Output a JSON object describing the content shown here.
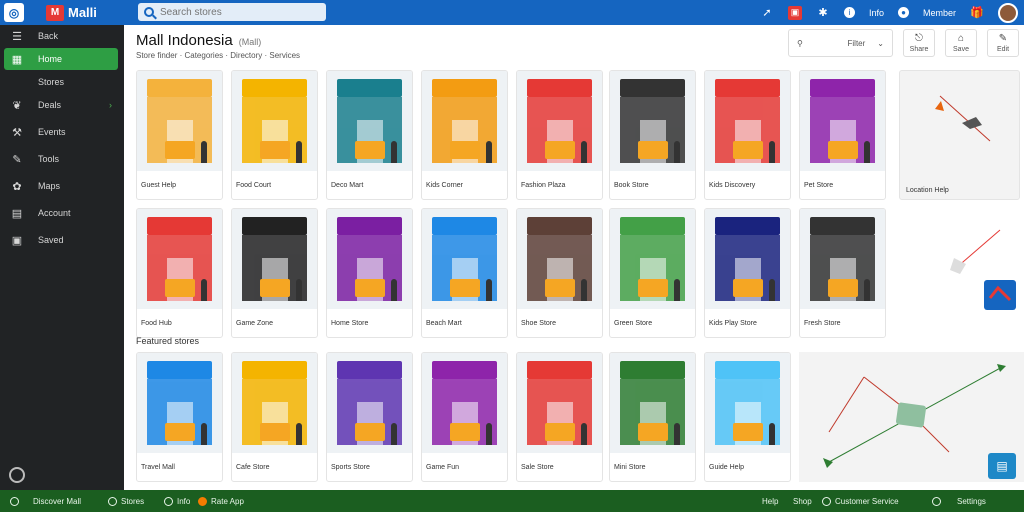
{
  "topbar": {
    "app_icon": "globe-icon",
    "brand_name": "Malli",
    "brand_mark": "M",
    "search_placeholder": "Search stores",
    "icons": [
      "pin-icon",
      "store-badge-icon",
      "bluetooth-icon",
      "info-icon"
    ],
    "info_label": "Info",
    "user_label": "Member",
    "gift_icon": "gift-icon"
  },
  "sidebar": {
    "items": [
      {
        "label": "Back",
        "icon": "menu-icon",
        "active": false
      },
      {
        "label": "Home",
        "icon": "store-icon",
        "active": true
      },
      {
        "label": "Stores",
        "icon": "",
        "active": false
      },
      {
        "label": "Deals",
        "icon": "leaf-icon",
        "active": false,
        "chevron": true
      },
      {
        "label": "Events",
        "icon": "wrench-icon",
        "active": false
      },
      {
        "label": "Tools",
        "icon": "brush-icon",
        "active": false
      },
      {
        "label": "Maps",
        "icon": "gear-icon",
        "active": false
      },
      {
        "label": "Account",
        "icon": "document-icon",
        "active": false
      },
      {
        "label": "Saved",
        "icon": "bag-icon",
        "active": false
      }
    ]
  },
  "main": {
    "title": "Mall Indonesia",
    "title_tag": "(Mall)",
    "subtitle": "Store finder  ·  Categories  ·  Directory  ·  Services",
    "filter_label": "Filter",
    "actions": [
      {
        "label": "Share",
        "icon": "share-icon"
      },
      {
        "label": "Save",
        "icon": "bag-icon"
      },
      {
        "label": "Edit",
        "icon": "edit-icon"
      }
    ],
    "section_label": "Featured stores"
  },
  "cards_row1": [
    {
      "caption": "Guest Help",
      "sign": "",
      "color": "#f4b23c"
    },
    {
      "caption": "Food Court",
      "sign": "",
      "color": "#f4b400"
    },
    {
      "caption": "Deco Mart",
      "sign": "",
      "color": "#1a7f8e"
    },
    {
      "caption": "Kids Corner",
      "sign": "",
      "color": "#f39c12"
    },
    {
      "caption": "Fashion Plaza",
      "sign": "",
      "color": "#e53935"
    },
    {
      "caption": "Book Store",
      "sign": "",
      "color": "#333333"
    },
    {
      "caption": "Kids Discovery",
      "sign": "",
      "color": "#e53935"
    },
    {
      "caption": "Pet Store",
      "sign": "",
      "color": "#8e24aa"
    }
  ],
  "cards_row2": [
    {
      "caption": "Food Hub",
      "sign": "",
      "color": "#e53935"
    },
    {
      "caption": "Game Zone",
      "sign": "",
      "color": "#222222"
    },
    {
      "caption": "Home Store",
      "sign": "",
      "color": "#7b1fa2"
    },
    {
      "caption": "Beach Mart",
      "sign": "",
      "color": "#1e88e5"
    },
    {
      "caption": "Shoe Store",
      "sign": "",
      "color": "#5d4037"
    },
    {
      "caption": "Green Store",
      "sign": "",
      "color": "#43a047"
    },
    {
      "caption": "Kids Play Store",
      "sign": "",
      "color": "#1a237e"
    },
    {
      "caption": "Fresh Store",
      "sign": "",
      "color": "#333333"
    }
  ],
  "cards_row3": [
    {
      "caption": "Travel Mall",
      "sign": "",
      "color": "#1e88e5"
    },
    {
      "caption": "Cafe Store",
      "sign": "",
      "color": "#f4b400"
    },
    {
      "caption": "Sports Store",
      "sign": "",
      "color": "#5e35b1"
    },
    {
      "caption": "Game Fun",
      "sign": "",
      "color": "#8e24aa"
    },
    {
      "caption": "Sale Store",
      "sign": "",
      "color": "#e53935"
    },
    {
      "caption": "Mini Store",
      "sign": "",
      "color": "#2e7d32"
    },
    {
      "caption": "Guide Help",
      "sign": "",
      "color": "#4fc3f7"
    }
  ],
  "side_cards": [
    {
      "caption": "Location Help",
      "icon": "map-pin-icon"
    },
    {
      "caption": "",
      "icon": "route-icon"
    }
  ],
  "chat_icon": "chat-icon",
  "bottombar": {
    "brand": "Discover Mall",
    "items": [
      "Stores",
      "Info",
      "Rate App"
    ],
    "right_items": [
      "Help",
      "Shop",
      "Customer Service",
      "Settings"
    ]
  },
  "colors": {
    "topbar": "#1565c0",
    "sidebar": "#212325",
    "active": "#2e9e44",
    "bottombar": "#1b5e20"
  }
}
